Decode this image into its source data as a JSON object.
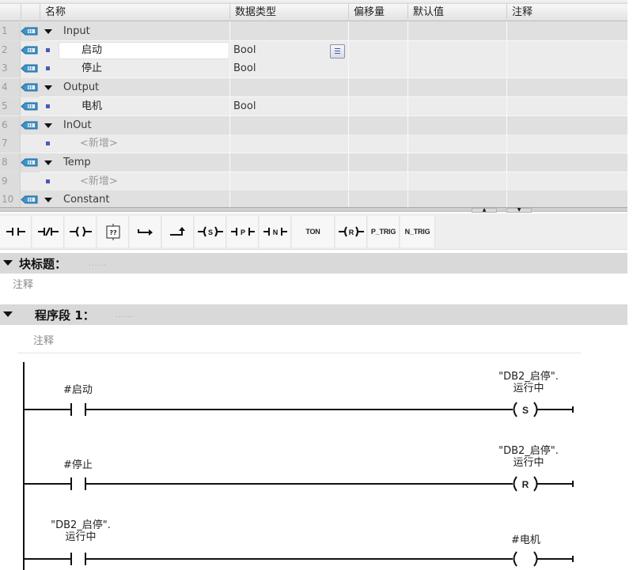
{
  "interface_table": {
    "columns": [
      "名称",
      "数据类型",
      "偏移量",
      "默认值",
      "注释"
    ],
    "rows": [
      {
        "num": "1",
        "kind": "group",
        "name": "Input",
        "datatype": ""
      },
      {
        "num": "2",
        "kind": "var",
        "name": "启动",
        "datatype": "Bool",
        "selected": true
      },
      {
        "num": "3",
        "kind": "var",
        "name": "停止",
        "datatype": "Bool"
      },
      {
        "num": "4",
        "kind": "group",
        "name": "Output",
        "datatype": ""
      },
      {
        "num": "5",
        "kind": "var",
        "name": "电机",
        "datatype": "Bool"
      },
      {
        "num": "6",
        "kind": "group",
        "name": "InOut",
        "datatype": ""
      },
      {
        "num": "7",
        "kind": "new",
        "name": "<新增>",
        "datatype": ""
      },
      {
        "num": "8",
        "kind": "group",
        "name": "Temp",
        "datatype": ""
      },
      {
        "num": "9",
        "kind": "new",
        "name": "<新增>",
        "datatype": ""
      },
      {
        "num": "10",
        "kind": "group",
        "name": "Constant",
        "datatype": ""
      }
    ],
    "scroll_up_icon": "▲",
    "scroll_down_icon": "▼"
  },
  "toolbar": {
    "items": [
      {
        "id": "no-contact",
        "label": ""
      },
      {
        "id": "nc-contact",
        "label": ""
      },
      {
        "id": "coil",
        "label": ""
      },
      {
        "id": "empty-box",
        "label": "??"
      },
      {
        "id": "open-branch",
        "label": ""
      },
      {
        "id": "close-branch",
        "label": ""
      },
      {
        "id": "set-coil",
        "label": "S"
      },
      {
        "id": "p-contact",
        "label": "P"
      },
      {
        "id": "n-contact",
        "label": "N"
      },
      {
        "id": "ton",
        "label": "TON"
      },
      {
        "id": "reset-coil",
        "label": "R"
      },
      {
        "id": "p-trig",
        "label": "P_TRIG"
      },
      {
        "id": "n-trig",
        "label": "N_TRIG"
      }
    ]
  },
  "block": {
    "title_label": "块标题：",
    "title_placeholder": "......",
    "comment": "注释"
  },
  "network": {
    "title_label": "程序段 1：",
    "title_placeholder": "......",
    "comment": "注释",
    "rungs": [
      {
        "contact": "#启动",
        "contact_type": "NO",
        "coil_line1": "\"DB2_启停\".",
        "coil_line2": "运行中",
        "coil_type": "S"
      },
      {
        "contact": "#停止",
        "contact_type": "NO",
        "coil_line1": "\"DB2_启停\".",
        "coil_line2": "运行中",
        "coil_type": "R"
      },
      {
        "contact_line1": "\"DB2_启停\".",
        "contact_line2": "运行中",
        "contact_type": "NO",
        "coil": "#电机",
        "coil_type": ""
      }
    ]
  }
}
